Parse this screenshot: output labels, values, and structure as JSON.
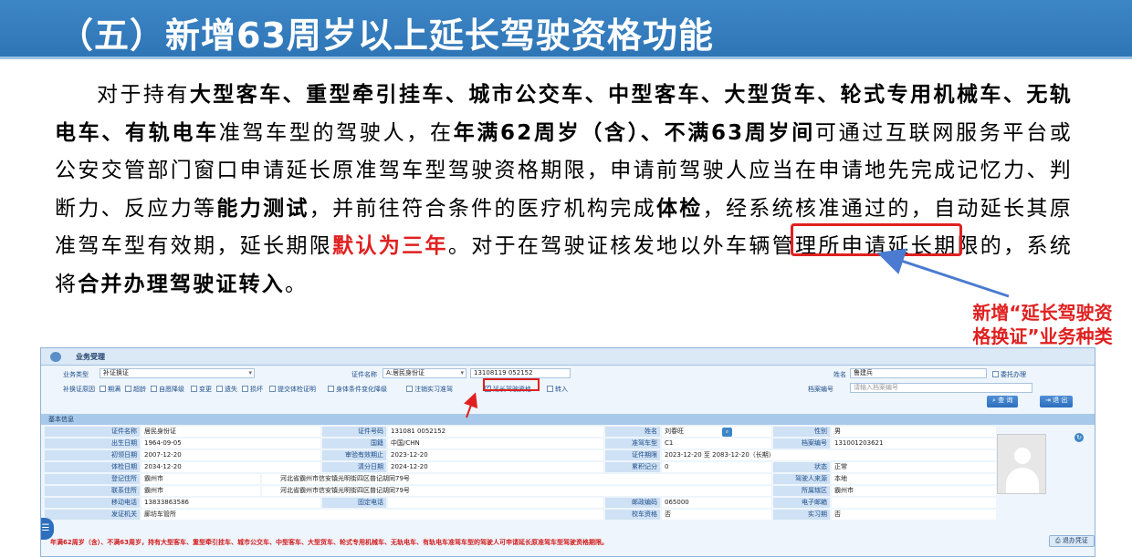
{
  "colors": {
    "title_bg": "#2e75b6",
    "accent_red": "#e02020",
    "panel_bg": "#eef5fc"
  },
  "title": "（五）新增63周岁以上延长驾驶资格功能",
  "paragraph": {
    "s1": "对于持有",
    "b1": "大型客车、重型牵引挂车、城市公交车、中型客车、大型货车、轮式专用机械车、无轨电车、有轨电车",
    "s2": "准驾车型的驾驶人，在",
    "b2": "年满62周岁（含）、不满63周岁间",
    "s3": "可通过互联网服务平台或公安交管部门窗口申请延长原准驾车型驾驶资格期限，申请前驾驶人应当在申请地先完成记忆力、判断力、反应力等",
    "b3": "能力测试",
    "s4": "，并前往符合条件的医疗机构完成",
    "b4": "体检",
    "s5": "，经系统核准通过的，自动延长其原准驾车型有效期，延长期限",
    "r1": "默认为三年",
    "s6": "。对于在驾驶证核发地以外车辆管理所申请延长期限的，系统将",
    "b5": "合并办理驾驶证转入",
    "s7": "。"
  },
  "annotation": {
    "line1": "新增“延长驾驶资",
    "line2": "格换证”业务种类"
  },
  "screenshot": {
    "tab_label": "业务受理",
    "query": {
      "business_type_label": "业务类型",
      "business_type_value": "补证换证",
      "cert_name_label": "证件名称",
      "cert_name_value": "A:居民身份证",
      "cert_no_value": "13108119        052152",
      "name_label": "姓名",
      "name_value": "鲁建兵",
      "entrust_label": "委托办理",
      "reason_label": "补换证原因",
      "archive_label": "档案编号",
      "archive_placeholder": "请输入档案编号",
      "query_btn": "查 询",
      "exit_btn": "退 出",
      "options": [
        "期满",
        "超龄",
        "自愿降级",
        "变更",
        "遗失",
        "损坏",
        "提交体检证明",
        "身体条件变化降级",
        "注销实习准驾",
        "延长驾驶资格",
        "转入"
      ]
    },
    "section_title": "基本信息",
    "fields": [
      [
        "证件名称",
        "居民身份证",
        "证件号码",
        "131081          0052152",
        "姓名",
        "刘春旺",
        "性别",
        "男"
      ],
      [
        "出生日期",
        "1964-09-05",
        "国籍",
        "中国/CHN",
        "准驾车型",
        "C1",
        "档案编号",
        "131001203621"
      ],
      [
        "初领日期",
        "2007-12-20",
        "审验有效期止",
        "2023-12-20",
        "证件期限",
        "2023-12-20 至 2083-12-20（长期）",
        "",
        ""
      ],
      [
        "体检日期",
        "2034-12-20",
        "清分日期",
        "2024-12-20",
        "累积记分",
        "0",
        "状态",
        "正常"
      ],
      [
        "登记住所",
        "霸州市",
        "河北省霸州市信安镇光明街四区普记胡同79号",
        "",
        "",
        "",
        "驾驶人来源",
        "本地"
      ],
      [
        "联系住所",
        "霸州市",
        "河北省霸州市信安镇光明街四区普记胡同79号",
        "",
        "",
        "",
        "所属辖区",
        "霸州市"
      ],
      [
        "移动电话",
        "13833863586",
        "固定电话",
        "",
        "邮政编码",
        "065000",
        "电子邮箱",
        ""
      ],
      [
        "发证机关",
        "廊坊车管所",
        "",
        "",
        "校车资格",
        "否",
        "实习期",
        "否"
      ]
    ],
    "footer_note": "年满62周岁（含）、不满63周岁，持有大型客车、重型牵引挂车、城市公交车、中型客车、大型货车、轮式专用机械车、无轨电车、有轨电车准驾车型的驾驶人可申请延长原准驾车型驾驶资格期限。",
    "return_btn": "退办凭证"
  }
}
